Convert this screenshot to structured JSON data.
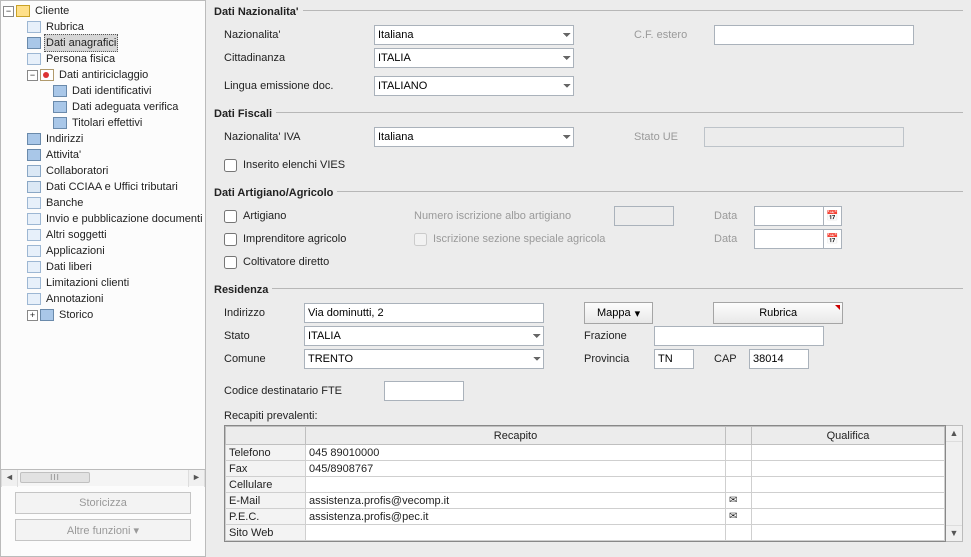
{
  "tree": {
    "root": "Cliente",
    "items": [
      "Rubrica",
      "Dati anagrafici",
      "Persona fisica",
      "Dati antiriciclaggio",
      "Dati identificativi",
      "Dati adeguata verifica",
      "Titolari effettivi",
      "Indirizzi",
      "Attivita'",
      "Collaboratori",
      "Dati CCIAA e Uffici tributari",
      "Banche",
      "Invio e pubblicazione documenti",
      "Altri soggetti",
      "Applicazioni",
      "Dati liberi",
      "Limitazioni clienti",
      "Annotazioni",
      "Storico"
    ],
    "scroll_label": "III"
  },
  "sidebar_buttons": {
    "storicizza": "Storicizza",
    "altre": "Altre funzioni"
  },
  "nazionalita": {
    "title": "Dati Nazionalita'",
    "naz_lbl": "Nazionalita'",
    "naz_val": "Italiana",
    "citt_lbl": "Cittadinanza",
    "citt_val": "ITALIA",
    "cfest_lbl": "C.F. estero",
    "lingua_lbl": "Lingua emissione doc.",
    "lingua_val": "ITALIANO"
  },
  "fiscali": {
    "title": "Dati Fiscali",
    "naziva_lbl": "Nazionalita' IVA",
    "naziva_val": "Italiana",
    "statoue_lbl": "Stato UE",
    "vies_lbl": "Inserito elenchi VIES"
  },
  "artigiano": {
    "title": "Dati Artigiano/Agricolo",
    "art_lbl": "Artigiano",
    "impr_lbl": "Imprenditore agricolo",
    "colt_lbl": "Coltivatore diretto",
    "numisc_lbl": "Numero iscrizione albo artigiano",
    "iscsez_lbl": "Iscrizione sezione speciale agricola",
    "data_lbl": "Data"
  },
  "residenza": {
    "title": "Residenza",
    "ind_lbl": "Indirizzo",
    "ind_val": "Via dominutti, 2",
    "stato_lbl": "Stato",
    "stato_val": "ITALIA",
    "comune_lbl": "Comune",
    "comune_val": "TRENTO",
    "fraz_lbl": "Frazione",
    "prov_lbl": "Provincia",
    "prov_val": "TN",
    "cap_lbl": "CAP",
    "cap_val": "38014",
    "mappa_btn": "Mappa",
    "rubrica_btn": "Rubrica",
    "codfte_lbl": "Codice destinatario FTE"
  },
  "recapiti": {
    "title": "Recapiti prevalenti:",
    "col_recapito": "Recapito",
    "col_qualifica": "Qualifica",
    "rows": [
      {
        "label": "Telefono",
        "value": "045 89010000"
      },
      {
        "label": "Fax",
        "value": "045/8908767"
      },
      {
        "label": "Cellulare",
        "value": ""
      },
      {
        "label": "E-Mail",
        "value": "assistenza.profis@vecomp.it"
      },
      {
        "label": "P.E.C.",
        "value": "assistenza.profis@pec.it"
      },
      {
        "label": "Sito Web",
        "value": ""
      }
    ]
  }
}
